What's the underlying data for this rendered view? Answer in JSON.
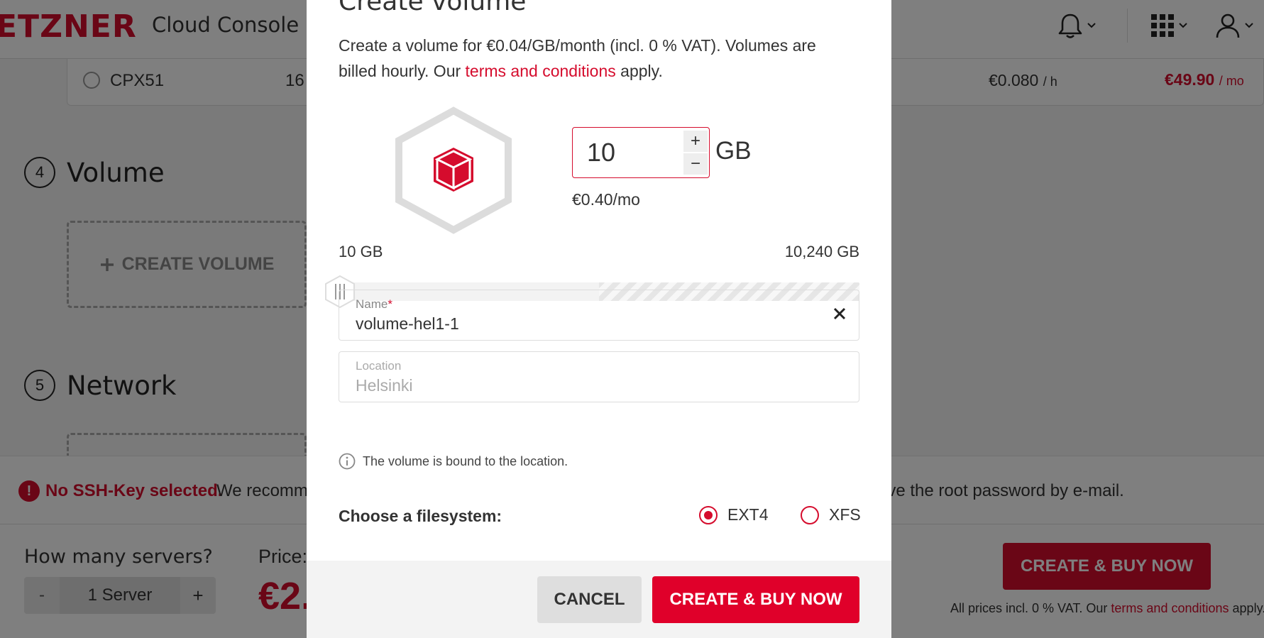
{
  "header": {
    "logo_text": "ETZNER",
    "title": "Cloud Console",
    "icons": [
      "bell-icon",
      "apps-grid-icon",
      "user-icon"
    ]
  },
  "server_row": {
    "name": "CPX51",
    "cores": "16",
    "hourly_price": "€0.080",
    "hourly_unit": "/ h",
    "monthly_price": "€49.90",
    "monthly_unit": "/ mo"
  },
  "steps": {
    "volume": {
      "number": "4",
      "title": "Volume",
      "create_label": "CREATE VOLUME"
    },
    "network": {
      "number": "5",
      "title": "Network"
    }
  },
  "warning": {
    "strong": "No SSH-Key selected.",
    "text_left": "We recomm",
    "text_right": "ive the root password by e-mail."
  },
  "footer": {
    "question": "How many servers?",
    "stepper_minus": "-",
    "stepper_value": "1 Server",
    "stepper_plus": "+",
    "price_label": "Price:",
    "price_value": "€2.",
    "buy_label": "CREATE & BUY NOW",
    "note_prefix": "All prices incl. 0 % VAT. Our",
    "note_link": "terms and conditions",
    "note_suffix": "apply."
  },
  "modal": {
    "title": "Create volume",
    "intro_text": "Create a volume for €0.04/GB/month (incl. 0 % VAT). Volumes are billed hourly. Our",
    "intro_link": "terms and conditions",
    "intro_suffix": "apply.",
    "size_value": "10",
    "size_unit": "GB",
    "size_plus": "+",
    "size_minus": "−",
    "monthly_price": "€0.40/mo",
    "range_min": "10 GB",
    "range_max": "10,240 GB",
    "slider_value_gb": 10,
    "name_label": "Name",
    "name_required": "*",
    "name_value": "volume-hel1-1",
    "location_label": "Location",
    "location_value": "Helsinki",
    "info_text": "The volume is bound to the location.",
    "filesystem_label": "Choose a filesystem:",
    "filesystem_options": [
      "EXT4",
      "XFS"
    ],
    "filesystem_selected": "EXT4",
    "cancel_label": "CANCEL",
    "buy_label": "CREATE & BUY NOW"
  },
  "colors": {
    "brand": "#d50c2d",
    "button_red": "#e0002a",
    "overlay": "rgba(0,0,0,0.5)"
  }
}
